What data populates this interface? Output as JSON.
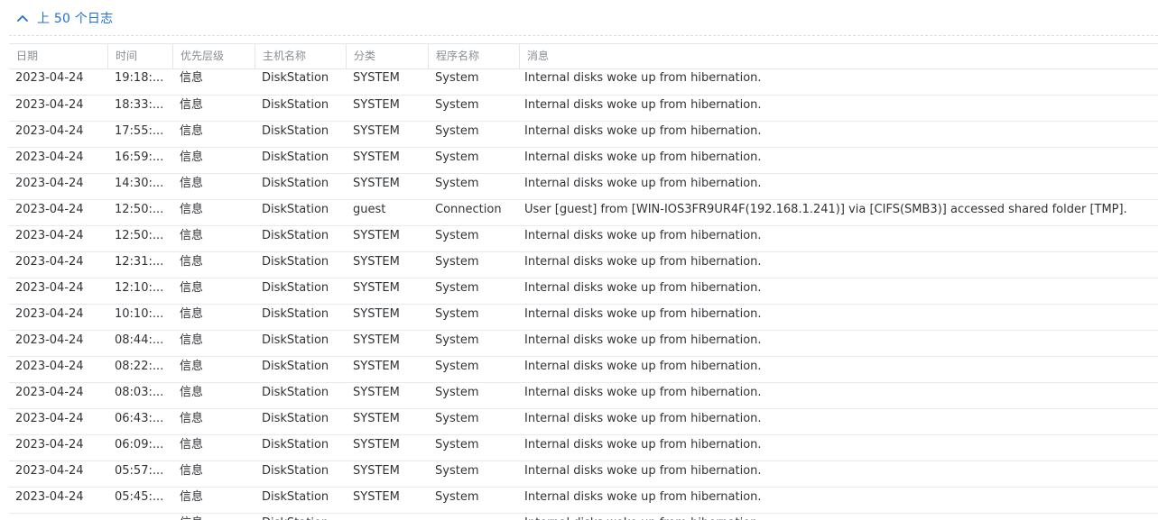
{
  "section": {
    "title": "上 50 个日志",
    "chevron_icon": "chevron-up-icon",
    "accent_color": "#1f6fd6"
  },
  "table": {
    "columns": [
      "日期",
      "时间",
      "优先层级",
      "主机名称",
      "分类",
      "程序名称",
      "消息"
    ],
    "rows": [
      {
        "date": "2023-04-24",
        "time": "19:18:...",
        "priority": "信息",
        "host": "DiskStation",
        "category": "SYSTEM",
        "program": "System",
        "message": "Internal disks woke up from hibernation."
      },
      {
        "date": "2023-04-24",
        "time": "18:33:...",
        "priority": "信息",
        "host": "DiskStation",
        "category": "SYSTEM",
        "program": "System",
        "message": "Internal disks woke up from hibernation."
      },
      {
        "date": "2023-04-24",
        "time": "17:55:...",
        "priority": "信息",
        "host": "DiskStation",
        "category": "SYSTEM",
        "program": "System",
        "message": "Internal disks woke up from hibernation."
      },
      {
        "date": "2023-04-24",
        "time": "16:59:...",
        "priority": "信息",
        "host": "DiskStation",
        "category": "SYSTEM",
        "program": "System",
        "message": "Internal disks woke up from hibernation."
      },
      {
        "date": "2023-04-24",
        "time": "14:30:...",
        "priority": "信息",
        "host": "DiskStation",
        "category": "SYSTEM",
        "program": "System",
        "message": "Internal disks woke up from hibernation."
      },
      {
        "date": "2023-04-24",
        "time": "12:50:...",
        "priority": "信息",
        "host": "DiskStation",
        "category": "guest",
        "program": "Connection",
        "message": "User [guest] from [WIN-IOS3FR9UR4F(192.168.1.241)] via [CIFS(SMB3)] accessed shared folder [TMP]."
      },
      {
        "date": "2023-04-24",
        "time": "12:50:...",
        "priority": "信息",
        "host": "DiskStation",
        "category": "SYSTEM",
        "program": "System",
        "message": "Internal disks woke up from hibernation."
      },
      {
        "date": "2023-04-24",
        "time": "12:31:...",
        "priority": "信息",
        "host": "DiskStation",
        "category": "SYSTEM",
        "program": "System",
        "message": "Internal disks woke up from hibernation."
      },
      {
        "date": "2023-04-24",
        "time": "12:10:...",
        "priority": "信息",
        "host": "DiskStation",
        "category": "SYSTEM",
        "program": "System",
        "message": "Internal disks woke up from hibernation."
      },
      {
        "date": "2023-04-24",
        "time": "10:10:...",
        "priority": "信息",
        "host": "DiskStation",
        "category": "SYSTEM",
        "program": "System",
        "message": "Internal disks woke up from hibernation."
      },
      {
        "date": "2023-04-24",
        "time": "08:44:...",
        "priority": "信息",
        "host": "DiskStation",
        "category": "SYSTEM",
        "program": "System",
        "message": "Internal disks woke up from hibernation."
      },
      {
        "date": "2023-04-24",
        "time": "08:22:...",
        "priority": "信息",
        "host": "DiskStation",
        "category": "SYSTEM",
        "program": "System",
        "message": "Internal disks woke up from hibernation."
      },
      {
        "date": "2023-04-24",
        "time": "08:03:...",
        "priority": "信息",
        "host": "DiskStation",
        "category": "SYSTEM",
        "program": "System",
        "message": "Internal disks woke up from hibernation."
      },
      {
        "date": "2023-04-24",
        "time": "06:43:...",
        "priority": "信息",
        "host": "DiskStation",
        "category": "SYSTEM",
        "program": "System",
        "message": "Internal disks woke up from hibernation."
      },
      {
        "date": "2023-04-24",
        "time": "06:09:...",
        "priority": "信息",
        "host": "DiskStation",
        "category": "SYSTEM",
        "program": "System",
        "message": "Internal disks woke up from hibernation."
      },
      {
        "date": "2023-04-24",
        "time": "05:57:...",
        "priority": "信息",
        "host": "DiskStation",
        "category": "SYSTEM",
        "program": "System",
        "message": "Internal disks woke up from hibernation."
      },
      {
        "date": "2023-04-24",
        "time": "05:45:...",
        "priority": "信息",
        "host": "DiskStation",
        "category": "SYSTEM",
        "program": "System",
        "message": "Internal disks woke up from hibernation."
      },
      {
        "date": "",
        "time": "",
        "priority": "信息",
        "host": "DiskStation",
        "category": "",
        "program": "",
        "message": "Internal disks woke up from hibernation."
      }
    ]
  }
}
